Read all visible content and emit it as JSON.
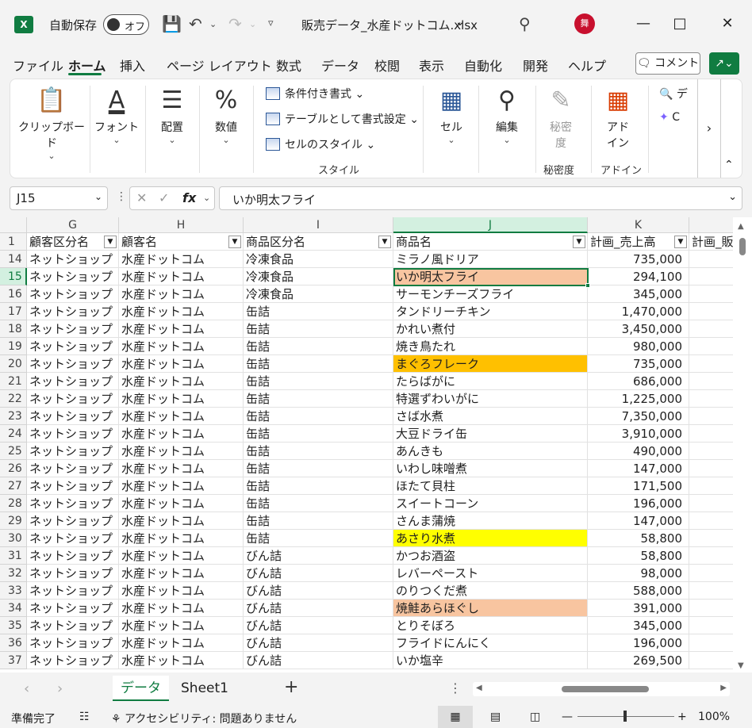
{
  "titlebar": {
    "app_icon": "X",
    "autosave_label": "自動保存",
    "autosave_state": "オフ",
    "filename": "販売データ_水産ドットコム.xlsx",
    "avatar_text": "舞"
  },
  "tabs": [
    {
      "label": "ファイル"
    },
    {
      "label": "ホーム"
    },
    {
      "label": "挿入"
    },
    {
      "label": "ページ レイアウト"
    },
    {
      "label": "数式"
    },
    {
      "label": "データ"
    },
    {
      "label": "校閲"
    },
    {
      "label": "表示"
    },
    {
      "label": "自動化"
    },
    {
      "label": "開発"
    },
    {
      "label": "ヘルプ"
    }
  ],
  "comment_label": "コメント",
  "ribbon": {
    "clipboard": "クリップボード",
    "font": "フォント",
    "alignment": "配置",
    "number": "数値",
    "cond_format": "条件付き書式",
    "table_format": "テーブルとして書式設定",
    "cell_style": "セルのスタイル",
    "style_group": "スタイル",
    "cells": "セル",
    "editing": "編集",
    "sensitivity_top": "秘密",
    "sensitivity_bot": "度",
    "sensitivity_group": "秘密度",
    "addin_top": "アド",
    "addin_bot": "イン",
    "addin_group": "アドイン",
    "extra1": "デ",
    "extra2": "C"
  },
  "formula_bar": {
    "name_box": "J15",
    "fx": "fx",
    "value": "いか明太フライ"
  },
  "columns": [
    {
      "letter": "G"
    },
    {
      "letter": "H"
    },
    {
      "letter": "I"
    },
    {
      "letter": "J"
    },
    {
      "letter": "K"
    }
  ],
  "header_row": {
    "num": "1",
    "cells": [
      "顧客区分名",
      "顧客名",
      "商品区分名",
      "商品名",
      "計画_売上高",
      "計画_販"
    ]
  },
  "rows": [
    {
      "num": "14",
      "g": "ネットショップ",
      "h": "水産ドットコム",
      "i": "冷凍食品",
      "j": "ミラノ風ドリア",
      "k": "735,000",
      "fill": ""
    },
    {
      "num": "15",
      "g": "ネットショップ",
      "h": "水産ドットコム",
      "i": "冷凍食品",
      "j": "いか明太フライ",
      "k": "294,100",
      "fill": "#f8c5a0"
    },
    {
      "num": "16",
      "g": "ネットショップ",
      "h": "水産ドットコム",
      "i": "冷凍食品",
      "j": "サーモンチーズフライ",
      "k": "345,000",
      "fill": ""
    },
    {
      "num": "17",
      "g": "ネットショップ",
      "h": "水産ドットコム",
      "i": "缶詰",
      "j": "タンドリーチキン",
      "k": "1,470,000",
      "fill": ""
    },
    {
      "num": "18",
      "g": "ネットショップ",
      "h": "水産ドットコム",
      "i": "缶詰",
      "j": "かれい煮付",
      "k": "3,450,000",
      "fill": ""
    },
    {
      "num": "19",
      "g": "ネットショップ",
      "h": "水産ドットコム",
      "i": "缶詰",
      "j": "焼き鳥たれ",
      "k": "980,000",
      "fill": ""
    },
    {
      "num": "20",
      "g": "ネットショップ",
      "h": "水産ドットコム",
      "i": "缶詰",
      "j": "まぐろフレーク",
      "k": "735,000",
      "fill": "#ffc000"
    },
    {
      "num": "21",
      "g": "ネットショップ",
      "h": "水産ドットコム",
      "i": "缶詰",
      "j": "たらばがに",
      "k": "686,000",
      "fill": ""
    },
    {
      "num": "22",
      "g": "ネットショップ",
      "h": "水産ドットコム",
      "i": "缶詰",
      "j": "特選ずわいがに",
      "k": "1,225,000",
      "fill": ""
    },
    {
      "num": "23",
      "g": "ネットショップ",
      "h": "水産ドットコム",
      "i": "缶詰",
      "j": "さば水煮",
      "k": "7,350,000",
      "fill": ""
    },
    {
      "num": "24",
      "g": "ネットショップ",
      "h": "水産ドットコム",
      "i": "缶詰",
      "j": "大豆ドライ缶",
      "k": "3,910,000",
      "fill": ""
    },
    {
      "num": "25",
      "g": "ネットショップ",
      "h": "水産ドットコム",
      "i": "缶詰",
      "j": "あんきも",
      "k": "490,000",
      "fill": ""
    },
    {
      "num": "26",
      "g": "ネットショップ",
      "h": "水産ドットコム",
      "i": "缶詰",
      "j": "いわし味噌煮",
      "k": "147,000",
      "fill": ""
    },
    {
      "num": "27",
      "g": "ネットショップ",
      "h": "水産ドットコム",
      "i": "缶詰",
      "j": "ほたて貝柱",
      "k": "171,500",
      "fill": ""
    },
    {
      "num": "28",
      "g": "ネットショップ",
      "h": "水産ドットコム",
      "i": "缶詰",
      "j": "スイートコーン",
      "k": "196,000",
      "fill": ""
    },
    {
      "num": "29",
      "g": "ネットショップ",
      "h": "水産ドットコム",
      "i": "缶詰",
      "j": "さんま蒲焼",
      "k": "147,000",
      "fill": ""
    },
    {
      "num": "30",
      "g": "ネットショップ",
      "h": "水産ドットコム",
      "i": "缶詰",
      "j": "あさり水煮",
      "k": "58,800",
      "fill": "#ffff00"
    },
    {
      "num": "31",
      "g": "ネットショップ",
      "h": "水産ドットコム",
      "i": "びん詰",
      "j": "かつお酒盗",
      "k": "58,800",
      "fill": ""
    },
    {
      "num": "32",
      "g": "ネットショップ",
      "h": "水産ドットコム",
      "i": "びん詰",
      "j": "レバーペースト",
      "k": "98,000",
      "fill": ""
    },
    {
      "num": "33",
      "g": "ネットショップ",
      "h": "水産ドットコム",
      "i": "びん詰",
      "j": "のりつくだ煮",
      "k": "588,000",
      "fill": ""
    },
    {
      "num": "34",
      "g": "ネットショップ",
      "h": "水産ドットコム",
      "i": "びん詰",
      "j": "焼鮭あらほぐし",
      "k": "391,000",
      "fill": "#f8c5a0"
    },
    {
      "num": "35",
      "g": "ネットショップ",
      "h": "水産ドットコム",
      "i": "びん詰",
      "j": "とりそぼろ",
      "k": "345,000",
      "fill": ""
    },
    {
      "num": "36",
      "g": "ネットショップ",
      "h": "水産ドットコム",
      "i": "びん詰",
      "j": "フライドにんにく",
      "k": "196,000",
      "fill": ""
    },
    {
      "num": "37",
      "g": "ネットショップ",
      "h": "水産ドットコム",
      "i": "びん詰",
      "j": "いか塩辛",
      "k": "269,500",
      "fill": ""
    }
  ],
  "sheets": [
    {
      "label": "データ",
      "active": true
    },
    {
      "label": "Sheet1",
      "active": false
    }
  ],
  "status": {
    "ready": "準備完了",
    "accessibility": "アクセシビリティ: 問題ありません",
    "zoom": "100%"
  },
  "colors": {
    "accent": "#107c41",
    "peach_fill": "#f8c5a0",
    "orange_fill": "#ffc000",
    "yellow_fill": "#ffff00"
  }
}
